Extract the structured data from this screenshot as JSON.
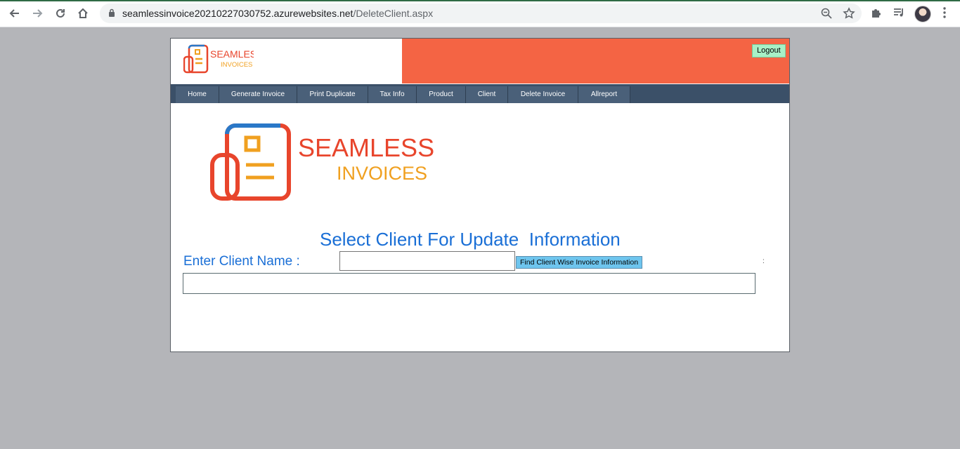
{
  "browser": {
    "url_host": "seamlessinvoice20210227030752.azurewebsites.net",
    "url_path": "/DeleteClient.aspx",
    "icons": [
      "back-arrow-icon",
      "forward-arrow-icon",
      "reload-icon",
      "home-icon",
      "lock-icon",
      "zoom-icon",
      "star-icon",
      "puzzle-icon",
      "media-control-icon",
      "avatar",
      "kebab-menu-icon"
    ]
  },
  "header": {
    "logo_line1": "SEAMLESS",
    "logo_line2": "INVOICES",
    "logout_label": "Logout",
    "accent_color": "#f46444",
    "menu_color": "#3b5068"
  },
  "menu": {
    "items": [
      "Home",
      "Generate Invoice",
      "Print Duplicate",
      "Tax Info",
      "Product",
      "Client",
      "Delete Invoice",
      "Allreport"
    ]
  },
  "main": {
    "logo_line1": "SEAMLESS",
    "logo_line2": "INVOICES",
    "title": "Select Client For Update  Information",
    "client_label": "Enter Client Name :",
    "client_value": "",
    "find_button": "Find Client Wise Invoice Information",
    "dot": ":",
    "title_color": "#1a6fd6"
  }
}
